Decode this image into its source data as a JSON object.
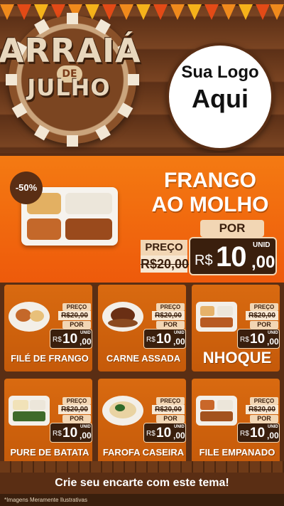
{
  "header": {
    "badge_title": "ARRAIÁ",
    "badge_de": "DE",
    "badge_subtitle": "JULHO",
    "logo_line1": "Sua Logo",
    "logo_line2": "Aqui"
  },
  "featured": {
    "discount": "-50%",
    "title_line1": "FRANGO",
    "title_line2": "AO MOLHO",
    "preco_label": "PREÇO",
    "old_price": "R$20,00",
    "por_label": "POR",
    "currency": "R$",
    "price_int": "10",
    "price_dec": ",00",
    "unit": "UNID"
  },
  "products": [
    {
      "name": "FILÉ DE FRANGO",
      "preco_label": "PREÇO",
      "old_price": "R$20,00",
      "por_label": "POR",
      "currency": "R$",
      "price_int": "10",
      "price_dec": ",00",
      "unit": "UNID"
    },
    {
      "name": "CARNE ASSADA",
      "preco_label": "PREÇO",
      "old_price": "R$20,00",
      "por_label": "POR",
      "currency": "R$",
      "price_int": "10",
      "price_dec": ",00",
      "unit": "UNID"
    },
    {
      "name": "NHOQUE",
      "preco_label": "PREÇO",
      "old_price": "R$20,00",
      "por_label": "POR",
      "currency": "R$",
      "price_int": "10",
      "price_dec": ",00",
      "unit": "UNID"
    },
    {
      "name": "PURE DE BATATA",
      "preco_label": "PREÇO",
      "old_price": "R$20,00",
      "por_label": "POR",
      "currency": "R$",
      "price_int": "10",
      "price_dec": ",00",
      "unit": "UNID"
    },
    {
      "name": "FAROFA CASEIRA",
      "preco_label": "PREÇO",
      "old_price": "R$20,00",
      "por_label": "POR",
      "currency": "R$",
      "price_int": "10",
      "price_dec": ",00",
      "unit": "UNID"
    },
    {
      "name": "FILE EMPANADO",
      "preco_label": "PREÇO",
      "old_price": "R$20,00",
      "por_label": "POR",
      "currency": "R$",
      "price_int": "10",
      "price_dec": ",00",
      "unit": "UNID"
    }
  ],
  "footer": {
    "cta": "Crie seu encarte com este tema!",
    "disclaimer": "*Imagens Meramente Ilustrativas"
  },
  "colors": {
    "wood": "#6b3a1c",
    "orange": "#f47a12",
    "dark_brown": "#3a1f0d",
    "cream": "#f2d6b4"
  }
}
